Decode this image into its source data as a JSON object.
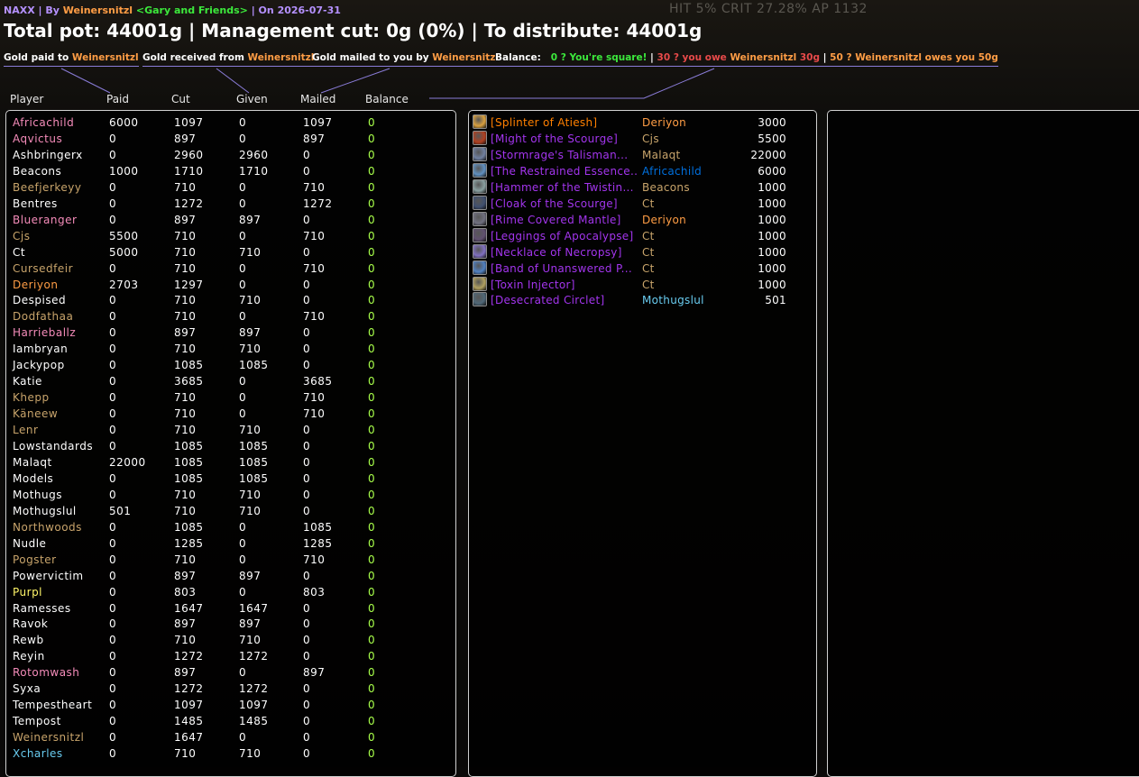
{
  "colors": {
    "title_purple": "#b591ff",
    "gold_name": "#ff9d45",
    "epic_item": "#a335ee",
    "legendary_item": "#ff8000",
    "balance_zero": "#3ce93c",
    "legend_underline": "#8a7cd8"
  },
  "hud": {
    "stats": "HIT 5%  CRIT 27.28%   AP 1132"
  },
  "header": {
    "raid": "NAXX",
    "by_label": " | By ",
    "author": "Weinersnitzl",
    "guild": "<Gary and Friends>",
    "date_text": " | On 2026-07-31"
  },
  "summary": {
    "text": "Total pot: 44001g | Management cut: 0g (0%) | To distribute: 44001g"
  },
  "legend": {
    "paid_prefix": "Gold paid to ",
    "received_prefix": "Gold received from ",
    "mailed_prefix": "Gold mailed to you by ",
    "name": "Weinersnitzl",
    "balance_label": "Balance:",
    "square": "0 ? You're square!",
    "sep": " | ",
    "owe_prefix": "30 ? you owe ",
    "owe_suffix": " 30g",
    "owes_prefix": "50 ? ",
    "owes_suffix": " owes you 50g"
  },
  "columns": {
    "player": "Player",
    "paid": "Paid",
    "cut": "Cut",
    "given": "Given",
    "mailed": "Mailed",
    "balance": "Balance"
  },
  "players": [
    {
      "name": "Africachild",
      "cls": "pink",
      "paid": "6000",
      "cut": "1097",
      "given": "0",
      "mailed": "1097",
      "balance": "0"
    },
    {
      "name": "Aqvictus",
      "cls": "pink",
      "paid": "0",
      "cut": "897",
      "given": "0",
      "mailed": "897",
      "balance": "0"
    },
    {
      "name": "Ashbringerx",
      "cls": "white",
      "paid": "0",
      "cut": "2960",
      "given": "2960",
      "mailed": "0",
      "balance": "0"
    },
    {
      "name": "Beacons",
      "cls": "white",
      "paid": "1000",
      "cut": "1710",
      "given": "1710",
      "mailed": "0",
      "balance": "0"
    },
    {
      "name": "Beefjerkeyy",
      "cls": "tan",
      "paid": "0",
      "cut": "710",
      "given": "0",
      "mailed": "710",
      "balance": "0"
    },
    {
      "name": "Bentres",
      "cls": "white",
      "paid": "0",
      "cut": "1272",
      "given": "0",
      "mailed": "1272",
      "balance": "0"
    },
    {
      "name": "Blueranger",
      "cls": "pink",
      "paid": "0",
      "cut": "897",
      "given": "897",
      "mailed": "0",
      "balance": "0"
    },
    {
      "name": "Cjs",
      "cls": "tan",
      "paid": "5500",
      "cut": "710",
      "given": "0",
      "mailed": "710",
      "balance": "0"
    },
    {
      "name": "Ct",
      "cls": "white",
      "paid": "5000",
      "cut": "710",
      "given": "710",
      "mailed": "0",
      "balance": "0"
    },
    {
      "name": "Cursedfeir",
      "cls": "tan",
      "paid": "0",
      "cut": "710",
      "given": "0",
      "mailed": "710",
      "balance": "0"
    },
    {
      "name": "Deriyon",
      "cls": "orange",
      "paid": "2703",
      "cut": "1297",
      "given": "0",
      "mailed": "0",
      "balance": "0"
    },
    {
      "name": "Despised",
      "cls": "white",
      "paid": "0",
      "cut": "710",
      "given": "710",
      "mailed": "0",
      "balance": "0"
    },
    {
      "name": "Dodfathaa",
      "cls": "tan",
      "paid": "0",
      "cut": "710",
      "given": "0",
      "mailed": "710",
      "balance": "0"
    },
    {
      "name": "Harrieballz",
      "cls": "pink",
      "paid": "0",
      "cut": "897",
      "given": "897",
      "mailed": "0",
      "balance": "0"
    },
    {
      "name": "Iambryan",
      "cls": "white",
      "paid": "0",
      "cut": "710",
      "given": "710",
      "mailed": "0",
      "balance": "0"
    },
    {
      "name": "Jackypop",
      "cls": "white",
      "paid": "0",
      "cut": "1085",
      "given": "1085",
      "mailed": "0",
      "balance": "0"
    },
    {
      "name": "Katie",
      "cls": "white",
      "paid": "0",
      "cut": "3685",
      "given": "0",
      "mailed": "3685",
      "balance": "0"
    },
    {
      "name": "Khepp",
      "cls": "tan",
      "paid": "0",
      "cut": "710",
      "given": "0",
      "mailed": "710",
      "balance": "0"
    },
    {
      "name": "Käneew",
      "cls": "tan",
      "paid": "0",
      "cut": "710",
      "given": "0",
      "mailed": "710",
      "balance": "0"
    },
    {
      "name": "Lenr",
      "cls": "tan",
      "paid": "0",
      "cut": "710",
      "given": "710",
      "mailed": "0",
      "balance": "0"
    },
    {
      "name": "Lowstandards",
      "cls": "white",
      "paid": "0",
      "cut": "1085",
      "given": "1085",
      "mailed": "0",
      "balance": "0"
    },
    {
      "name": "Malaqt",
      "cls": "white",
      "paid": "22000",
      "cut": "1085",
      "given": "1085",
      "mailed": "0",
      "balance": "0"
    },
    {
      "name": "Models",
      "cls": "white",
      "paid": "0",
      "cut": "1085",
      "given": "1085",
      "mailed": "0",
      "balance": "0"
    },
    {
      "name": "Mothugs",
      "cls": "white",
      "paid": "0",
      "cut": "710",
      "given": "710",
      "mailed": "0",
      "balance": "0"
    },
    {
      "name": "Mothugslul",
      "cls": "white",
      "paid": "501",
      "cut": "710",
      "given": "710",
      "mailed": "0",
      "balance": "0"
    },
    {
      "name": "Northwoods",
      "cls": "tan",
      "paid": "0",
      "cut": "1085",
      "given": "0",
      "mailed": "1085",
      "balance": "0"
    },
    {
      "name": "Nudle",
      "cls": "white",
      "paid": "0",
      "cut": "1285",
      "given": "0",
      "mailed": "1285",
      "balance": "0"
    },
    {
      "name": "Pogster",
      "cls": "tan",
      "paid": "0",
      "cut": "710",
      "given": "0",
      "mailed": "710",
      "balance": "0"
    },
    {
      "name": "Powervictim",
      "cls": "white",
      "paid": "0",
      "cut": "897",
      "given": "897",
      "mailed": "0",
      "balance": "0"
    },
    {
      "name": "Purpl",
      "cls": "yellow",
      "paid": "0",
      "cut": "803",
      "given": "0",
      "mailed": "803",
      "balance": "0"
    },
    {
      "name": "Ramesses",
      "cls": "white",
      "paid": "0",
      "cut": "1647",
      "given": "1647",
      "mailed": "0",
      "balance": "0"
    },
    {
      "name": "Ravok",
      "cls": "white",
      "paid": "0",
      "cut": "897",
      "given": "897",
      "mailed": "0",
      "balance": "0"
    },
    {
      "name": "Rewb",
      "cls": "white",
      "paid": "0",
      "cut": "710",
      "given": "710",
      "mailed": "0",
      "balance": "0"
    },
    {
      "name": "Reyin",
      "cls": "white",
      "paid": "0",
      "cut": "1272",
      "given": "1272",
      "mailed": "0",
      "balance": "0"
    },
    {
      "name": "Rotomwash",
      "cls": "pink",
      "paid": "0",
      "cut": "897",
      "given": "0",
      "mailed": "897",
      "balance": "0"
    },
    {
      "name": "Syxa",
      "cls": "white",
      "paid": "0",
      "cut": "1272",
      "given": "1272",
      "mailed": "0",
      "balance": "0"
    },
    {
      "name": "Tempestheart",
      "cls": "white",
      "paid": "0",
      "cut": "1097",
      "given": "1097",
      "mailed": "0",
      "balance": "0"
    },
    {
      "name": "Tempost",
      "cls": "white",
      "paid": "0",
      "cut": "1485",
      "given": "1485",
      "mailed": "0",
      "balance": "0"
    },
    {
      "name": "Weinersnitzl",
      "cls": "tan",
      "paid": "0",
      "cut": "1647",
      "given": "0",
      "mailed": "0",
      "balance": "0"
    },
    {
      "name": "Xcharles",
      "cls": "cyan",
      "paid": "0",
      "cut": "710",
      "given": "710",
      "mailed": "0",
      "balance": "0"
    }
  ],
  "items": [
    {
      "name": "[Splinter of Atiesh]",
      "quality": "legendary",
      "icon": "splinter-icon",
      "icon_color": "#d8a040",
      "winner": "Deriyon",
      "wcls": "orange",
      "price": "3000"
    },
    {
      "name": "[Might of the Scourge]",
      "quality": "epic",
      "icon": "shoulder-icon",
      "icon_color": "#b04020",
      "winner": "Cjs",
      "wcls": "tan",
      "price": "5500"
    },
    {
      "name": "[Stormrage's Talisman...",
      "quality": "epic",
      "icon": "talisman-icon",
      "icon_color": "#7080a0",
      "winner": "Malaqt",
      "wcls": "tan",
      "price": "22000"
    },
    {
      "name": "[The Restrained Essence...",
      "quality": "epic",
      "icon": "essence-icon",
      "icon_color": "#6090c0",
      "winner": "Africachild",
      "wcls": "blue",
      "price": "6000"
    },
    {
      "name": "[Hammer of the Twistin...",
      "quality": "epic",
      "icon": "hammer-icon",
      "icon_color": "#8aa0a0",
      "winner": "Beacons",
      "wcls": "tan",
      "price": "1000"
    },
    {
      "name": "[Cloak of the Scourge]",
      "quality": "epic",
      "icon": "cloak-icon",
      "icon_color": "#405070",
      "winner": "Ct",
      "wcls": "tan",
      "price": "1000"
    },
    {
      "name": "[Rime Covered Mantle]",
      "quality": "epic",
      "icon": "mantle-icon",
      "icon_color": "#707080",
      "winner": "Deriyon",
      "wcls": "orange",
      "price": "1000"
    },
    {
      "name": "[Leggings of Apocalypse]",
      "quality": "epic",
      "icon": "leggings-icon",
      "icon_color": "#605070",
      "winner": "Ct",
      "wcls": "tan",
      "price": "1000"
    },
    {
      "name": "[Necklace of Necropsy]",
      "quality": "epic",
      "icon": "necklace-icon",
      "icon_color": "#8070c0",
      "winner": "Ct",
      "wcls": "tan",
      "price": "1000"
    },
    {
      "name": "[Band of Unanswered P...",
      "quality": "epic",
      "icon": "ring-icon",
      "icon_color": "#5080c0",
      "winner": "Ct",
      "wcls": "tan",
      "price": "1000"
    },
    {
      "name": "[Toxin Injector]",
      "quality": "epic",
      "icon": "wand-icon",
      "icon_color": "#b0a060",
      "winner": "Ct",
      "wcls": "tan",
      "price": "1000"
    },
    {
      "name": "[Desecrated Circlet]",
      "quality": "epic",
      "icon": "circlet-icon",
      "icon_color": "#506878",
      "winner": "Mothugslul",
      "wcls": "cyan",
      "price": "501"
    }
  ]
}
